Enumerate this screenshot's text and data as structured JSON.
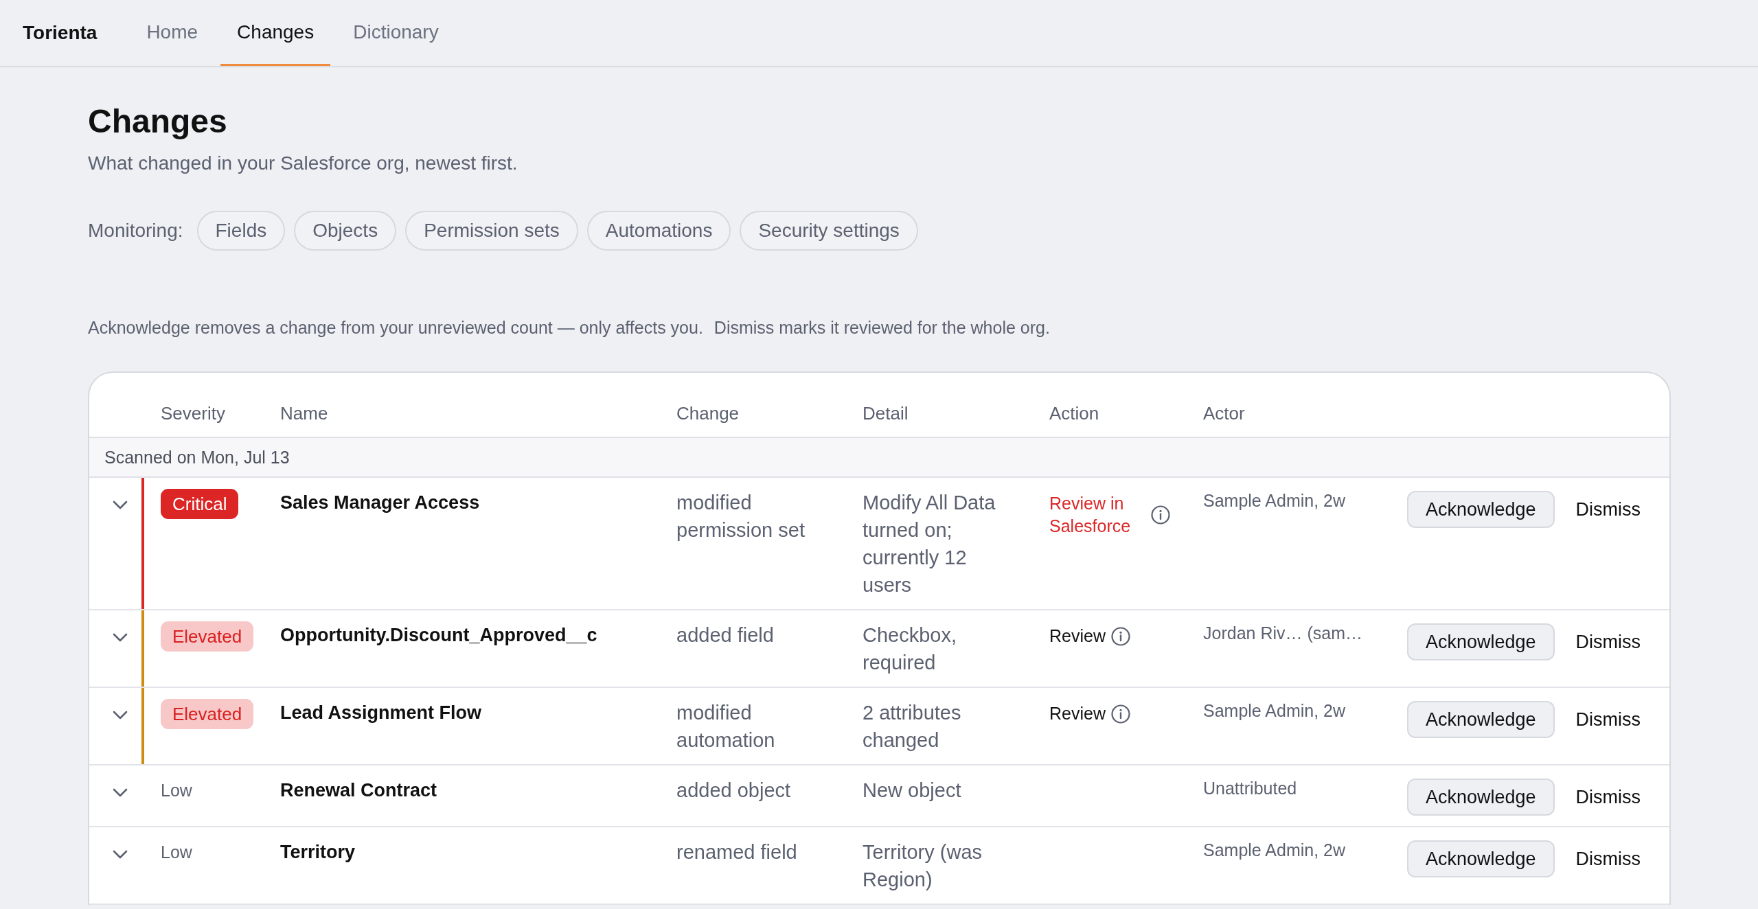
{
  "nav": {
    "brand": "Torienta",
    "tabs": [
      {
        "label": "Home",
        "selected": false
      },
      {
        "label": "Changes",
        "selected": true
      },
      {
        "label": "Dictionary",
        "selected": false
      }
    ]
  },
  "page": {
    "title": "Changes",
    "subtitle": "What changed in your Salesforce org, newest first."
  },
  "monitoring": {
    "label": "Monitoring:",
    "chips": [
      "Fields",
      "Objects",
      "Permission sets",
      "Automations",
      "Security settings"
    ]
  },
  "notes": [
    "Acknowledge removes a change from your unreviewed count — only affects you.",
    "Dismiss marks it reviewed for the whole org."
  ],
  "table": {
    "columns": [
      "Severity",
      "Name",
      "Change",
      "Detail",
      "Action",
      "Actor"
    ],
    "groups": [
      {
        "title": "Scanned on Mon, Jul 13",
        "rows": [
          {
            "expanded": false,
            "severity": {
              "kind": "critical",
              "label": "Critical"
            },
            "name": "Sales Manager Access",
            "change": "modified permission set",
            "detail": "Modify All Data turned on; currently 12 users",
            "action": {
              "label": "Review in Salesforce",
              "urgent": true
            },
            "actor": "Sample Admin, 2w",
            "acknowledge": "Acknowledge",
            "dismiss": "Dismiss"
          },
          {
            "expanded": false,
            "severity": {
              "kind": "elevated",
              "label": "Elevated"
            },
            "name": "Opportunity.Discount_Approved__c",
            "change": "added field",
            "detail": "Checkbox, required",
            "action": {
              "label": "Review",
              "urgent": false
            },
            "actor": "Jordan Riv… (sam…",
            "acknowledge": "Acknowledge",
            "dismiss": "Dismiss"
          },
          {
            "expanded": false,
            "severity": {
              "kind": "elevated",
              "label": "Elevated"
            },
            "name": "Lead Assignment Flow",
            "change": "modified automation",
            "detail": "2 attributes changed",
            "action": {
              "label": "Review",
              "urgent": false
            },
            "actor": "Sample Admin, 2w",
            "acknowledge": "Acknowledge",
            "dismiss": "Dismiss"
          },
          {
            "expanded": false,
            "severity": {
              "kind": "low",
              "label": "Low"
            },
            "name": "Renewal Contract",
            "change": "added object",
            "detail": "New object",
            "actor": "Unattributed",
            "acknowledge": "Acknowledge",
            "dismiss": "Dismiss"
          },
          {
            "expanded": false,
            "severity": {
              "kind": "low",
              "label": "Low"
            },
            "name": "Territory",
            "change": "renamed field",
            "detail": "Territory (was Region)",
            "actor": "Sample Admin, 2w",
            "acknowledge": "Acknowledge",
            "dismiss": "Dismiss"
          }
        ]
      }
    ]
  }
}
